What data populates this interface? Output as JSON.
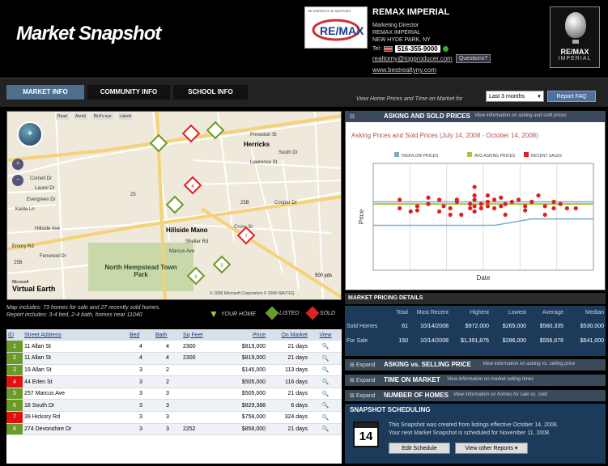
{
  "header": {
    "title": "Market Snapshot",
    "photo_banner": "RE DISPATCH 3D SUPPLIES",
    "company": "REMAX IMPERIAL",
    "agent_title": "Marketing Director",
    "agent_company": "REMAX IMPERIAL",
    "agent_city": "NEW HYDE PARK, NY",
    "tel_label": "Tel:",
    "phone": "516-355-9000",
    "email": "realtorny@topproducer.com",
    "questions_label": "Questions?",
    "website": "www.bestrealtyny.com",
    "logo_text": "RE/MAX",
    "logo_sub": "IMPERIAL"
  },
  "nav": {
    "tabs": [
      "MARKET INFO",
      "COMMUNITY INFO",
      "SCHOOL INFO"
    ],
    "view_label": "View Home Prices and Time on Market for",
    "period": "Last 3 months",
    "report_faq": "Report FAQ"
  },
  "map": {
    "toolbar": [
      "Road",
      "Aerial",
      "Bird's eye",
      "Labels"
    ],
    "streets": [
      {
        "name": "Herricks",
        "big": true
      },
      {
        "name": "Hillside Ave",
        "big": false
      },
      {
        "name": "Hillside Mano",
        "big": false
      },
      {
        "name": "Lawrence St",
        "big": false
      },
      {
        "name": "Cross St",
        "big": false
      },
      {
        "name": "Marcus Ave",
        "big": false
      },
      {
        "name": "Shelter Rd",
        "big": false
      },
      {
        "name": "South Dr",
        "big": false
      },
      {
        "name": "Laurel Dr",
        "big": false
      },
      {
        "name": "Evergreen Dr",
        "big": false
      },
      {
        "name": "Kalda Ln",
        "big": false
      },
      {
        "name": "Cornell Dr",
        "big": false
      },
      {
        "name": "Emory Rd",
        "big": false
      },
      {
        "name": "Fenwood Dr",
        "big": false
      },
      {
        "name": "Cooper Dr",
        "big": false
      },
      {
        "name": "Princeton St",
        "big": false
      }
    ],
    "route_labels": [
      "25B",
      "25B",
      "25"
    ],
    "park": "North Hempstead Town Park",
    "provider": "Virtual Earth",
    "provider_prefix": "Microsoft",
    "copyright": "© 2008 Microsoft Corporation © 2008 NAVTEQ",
    "scale": "500 yds",
    "info_line1": "Map includes: 73 homes for sale and 27 recently sold homes.",
    "info_line2": "Report includes: 3-4 bed, 2-4 bath, homes near 11040",
    "legend": {
      "your_home": "YOUR HOME",
      "listed": "LISTED",
      "sold": "SOLD"
    }
  },
  "listings": {
    "columns": [
      "ID",
      "Street Address",
      "Bed",
      "Bath",
      "Sq Feet",
      "Price",
      "On Market",
      "View"
    ],
    "rows": [
      {
        "id": "1",
        "address": "11 Allan St",
        "bed": "4",
        "bath": "4",
        "sqft": "2300",
        "price": "$819,000",
        "market": "21 days",
        "sold": false
      },
      {
        "id": "2",
        "address": "11 Allan St",
        "bed": "4",
        "bath": "4",
        "sqft": "2300",
        "price": "$819,000",
        "market": "21 days",
        "sold": false
      },
      {
        "id": "3",
        "address": "19 Allan St",
        "bed": "3",
        "bath": "2",
        "sqft": "",
        "price": "$145,000",
        "market": "113 days",
        "sold": false
      },
      {
        "id": "4",
        "address": "44 Erlen St",
        "bed": "3",
        "bath": "2",
        "sqft": "",
        "price": "$505,000",
        "market": "116 days",
        "sold": true
      },
      {
        "id": "5",
        "address": "257 Marcus Ave",
        "bed": "3",
        "bath": "3",
        "sqft": "",
        "price": "$505,000",
        "market": "21 days",
        "sold": false
      },
      {
        "id": "6",
        "address": "18 South Dr",
        "bed": "3",
        "bath": "3",
        "sqft": "",
        "price": "$829,388",
        "market": "6 days",
        "sold": false
      },
      {
        "id": "7",
        "address": "39 Hickory Rd",
        "bed": "3",
        "bath": "3",
        "sqft": "",
        "price": "$758,000",
        "market": "324 days",
        "sold": true
      },
      {
        "id": "8",
        "address": "274 Devonshire Dr",
        "bed": "3",
        "bath": "3",
        "sqft": "2252",
        "price": "$858,000",
        "market": "21 days",
        "sold": false
      }
    ]
  },
  "asking_sold": {
    "heading": "ASKING AND SOLD PRICES",
    "description": "View information on asking and sold prices",
    "chart_title": "Asking Prices and Sold Prices (July 14, 2008 - October 14, 2008)"
  },
  "chart_data": {
    "type": "scatter",
    "title": "Asking Prices and Sold Prices (July 14, 2008 - October 14, 2008)",
    "xlabel": "Date",
    "ylabel": "Price",
    "legend_position": "top",
    "legend": [
      "HIGH/LOW PRICES",
      "AVG ASKING PRICES",
      "RECENT SALES"
    ],
    "colors": {
      "highlow": "#7fa9c8",
      "avg": "#a8c83a",
      "sales": "#e02020"
    },
    "grid": true,
    "xlim": [
      0,
      100
    ],
    "ylim": [
      0,
      100
    ],
    "avg_asking": 62,
    "high_low": [
      [
        0,
        64
      ],
      [
        55,
        64
      ],
      [
        100,
        64
      ],
      [
        0,
        42
      ],
      [
        55,
        42
      ],
      [
        72,
        48
      ],
      [
        100,
        48
      ]
    ],
    "sales": [
      [
        12,
        66
      ],
      [
        12,
        58
      ],
      [
        17,
        55
      ],
      [
        20,
        56
      ],
      [
        20,
        60
      ],
      [
        25,
        62
      ],
      [
        25,
        68
      ],
      [
        30,
        66
      ],
      [
        30,
        55
      ],
      [
        32,
        60
      ],
      [
        35,
        52
      ],
      [
        35,
        58
      ],
      [
        38,
        64
      ],
      [
        38,
        66
      ],
      [
        40,
        52
      ],
      [
        44,
        58
      ],
      [
        44,
        62
      ],
      [
        46,
        55
      ],
      [
        46,
        78
      ],
      [
        46,
        60
      ],
      [
        46,
        66
      ],
      [
        46,
        70
      ],
      [
        49,
        58
      ],
      [
        49,
        62
      ],
      [
        52,
        70
      ],
      [
        52,
        64
      ],
      [
        52,
        60
      ],
      [
        55,
        66
      ],
      [
        55,
        58
      ],
      [
        58,
        68
      ],
      [
        58,
        60
      ],
      [
        60,
        52
      ],
      [
        60,
        62
      ],
      [
        63,
        64
      ],
      [
        66,
        66
      ],
      [
        69,
        60
      ],
      [
        69,
        56
      ],
      [
        72,
        64
      ],
      [
        75,
        70
      ],
      [
        78,
        60
      ],
      [
        78,
        52
      ],
      [
        82,
        58
      ],
      [
        82,
        64
      ],
      [
        85,
        62
      ],
      [
        88,
        58
      ],
      [
        92,
        58
      ]
    ]
  },
  "pricing": {
    "heading": "MARKET PRICING DETAILS",
    "columns": [
      "",
      "Total",
      "Most Recent",
      "Highest",
      "Lowest",
      "Average",
      "Median"
    ],
    "rows": [
      [
        "Sold Homes",
        "61",
        "10/14/2008",
        "$972,000",
        "$265,000",
        "$560,335",
        "$530,000"
      ],
      [
        "For Sale",
        "150",
        "10/14/2008",
        "$1,391,876",
        "$286,000",
        "$556,676",
        "$641,000"
      ]
    ]
  },
  "expand": [
    {
      "expand_label": "Expand",
      "title": "ASKING vs. SELLING PRICE",
      "desc": "View information on asking vs. selling price"
    },
    {
      "expand_label": "Expand",
      "title": "TIME ON MARKET",
      "desc": "View information on market selling times"
    },
    {
      "expand_label": "Expand",
      "title": "NUMBER OF HOMES",
      "desc": "View information on homes for sale vs. sold"
    }
  ],
  "scheduling": {
    "heading": "SNAPSHOT SCHEDULING",
    "day": "14",
    "message1": "This Snapshot was created from listings effective October 14, 2008.",
    "message2": "Your next Market Snapshot is scheduled for November 11, 2008",
    "edit_label": "Edit Schedule",
    "other_label": "View other Reports"
  }
}
